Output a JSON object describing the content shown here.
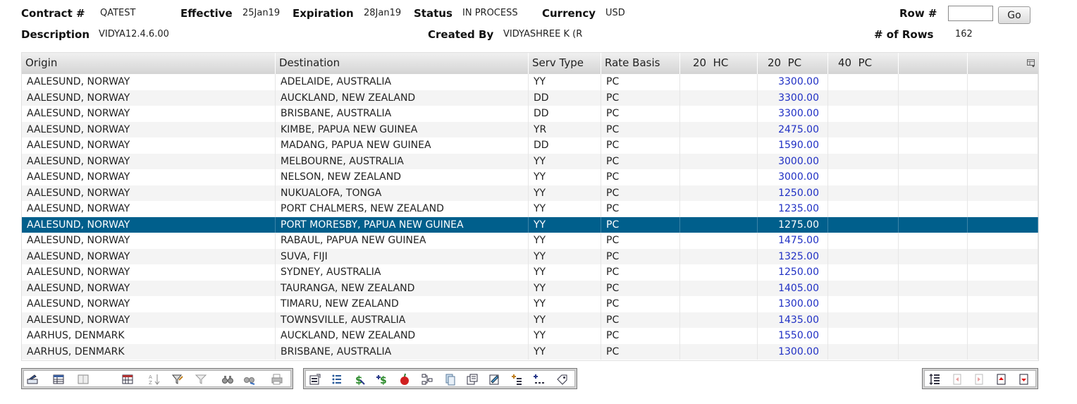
{
  "header": {
    "contract_label": "Contract #",
    "contract_value": "QATEST",
    "effective_label": "Effective",
    "effective_value": "25Jan19",
    "expiration_label": "Expiration",
    "expiration_value": "28Jan19",
    "status_label": "Status",
    "status_value": "IN PROCESS",
    "currency_label": "Currency",
    "currency_value": "USD",
    "row_label": "Row #",
    "row_input_value": "",
    "go_label": "Go",
    "description_label": "Description",
    "description_value": "VIDYA12.4.6.00",
    "created_by_label": "Created By",
    "created_by_value": "VIDYASHREE K (R",
    "rows_label": "# of Rows",
    "rows_value": "162"
  },
  "grid": {
    "columns": [
      "Origin",
      "Destination",
      "Serv Type",
      "Rate Basis",
      "20  HC",
      "20  PC",
      "40  PC",
      "",
      ""
    ],
    "selected_row": 9,
    "rows": [
      {
        "origin": "AALESUND, NORWAY",
        "destination": "ADELAIDE, AUSTRALIA",
        "serv": "YY",
        "basis": "PC",
        "hc20": "",
        "pc20": "3300.00",
        "pc40": ""
      },
      {
        "origin": "AALESUND, NORWAY",
        "destination": "AUCKLAND, NEW ZEALAND",
        "serv": "DD",
        "basis": "PC",
        "hc20": "",
        "pc20": "3300.00",
        "pc40": ""
      },
      {
        "origin": "AALESUND, NORWAY",
        "destination": "BRISBANE, AUSTRALIA",
        "serv": "DD",
        "basis": "PC",
        "hc20": "",
        "pc20": "3300.00",
        "pc40": ""
      },
      {
        "origin": "AALESUND, NORWAY",
        "destination": "KIMBE, PAPUA NEW GUINEA",
        "serv": "YR",
        "basis": "PC",
        "hc20": "",
        "pc20": "2475.00",
        "pc40": ""
      },
      {
        "origin": "AALESUND, NORWAY",
        "destination": "MADANG, PAPUA NEW GUINEA",
        "serv": "DD",
        "basis": "PC",
        "hc20": "",
        "pc20": "1590.00",
        "pc40": ""
      },
      {
        "origin": "AALESUND, NORWAY",
        "destination": "MELBOURNE, AUSTRALIA",
        "serv": "YY",
        "basis": "PC",
        "hc20": "",
        "pc20": "3000.00",
        "pc40": ""
      },
      {
        "origin": "AALESUND, NORWAY",
        "destination": "NELSON, NEW ZEALAND",
        "serv": "YY",
        "basis": "PC",
        "hc20": "",
        "pc20": "3000.00",
        "pc40": ""
      },
      {
        "origin": "AALESUND, NORWAY",
        "destination": "NUKUALOFA, TONGA",
        "serv": "YY",
        "basis": "PC",
        "hc20": "",
        "pc20": "1250.00",
        "pc40": ""
      },
      {
        "origin": "AALESUND, NORWAY",
        "destination": "PORT CHALMERS, NEW ZEALAND",
        "serv": "YY",
        "basis": "PC",
        "hc20": "",
        "pc20": "1235.00",
        "pc40": ""
      },
      {
        "origin": "AALESUND, NORWAY",
        "destination": "PORT MORESBY, PAPUA NEW GUINEA",
        "serv": "YY",
        "basis": "PC",
        "hc20": "",
        "pc20": "1275.00",
        "pc40": ""
      },
      {
        "origin": "AALESUND, NORWAY",
        "destination": "RABAUL, PAPUA NEW GUINEA",
        "serv": "YY",
        "basis": "PC",
        "hc20": "",
        "pc20": "1475.00",
        "pc40": ""
      },
      {
        "origin": "AALESUND, NORWAY",
        "destination": "SUVA, FIJI",
        "serv": "YY",
        "basis": "PC",
        "hc20": "",
        "pc20": "1325.00",
        "pc40": ""
      },
      {
        "origin": "AALESUND, NORWAY",
        "destination": "SYDNEY, AUSTRALIA",
        "serv": "YY",
        "basis": "PC",
        "hc20": "",
        "pc20": "1250.00",
        "pc40": ""
      },
      {
        "origin": "AALESUND, NORWAY",
        "destination": "TAURANGA, NEW ZEALAND",
        "serv": "YY",
        "basis": "PC",
        "hc20": "",
        "pc20": "1405.00",
        "pc40": ""
      },
      {
        "origin": "AALESUND, NORWAY",
        "destination": "TIMARU, NEW ZEALAND",
        "serv": "YY",
        "basis": "PC",
        "hc20": "",
        "pc20": "1300.00",
        "pc40": ""
      },
      {
        "origin": "AALESUND, NORWAY",
        "destination": "TOWNSVILLE, AUSTRALIA",
        "serv": "YY",
        "basis": "PC",
        "hc20": "",
        "pc20": "1435.00",
        "pc40": ""
      },
      {
        "origin": "AARHUS, DENMARK",
        "destination": "AUCKLAND, NEW ZEALAND",
        "serv": "YY",
        "basis": "PC",
        "hc20": "",
        "pc20": "1550.00",
        "pc40": ""
      },
      {
        "origin": "AARHUS, DENMARK",
        "destination": "BRISBANE, AUSTRALIA",
        "serv": "YY",
        "basis": "PC",
        "hc20": "",
        "pc20": "1300.00",
        "pc40": ""
      }
    ]
  },
  "toolbars": {
    "grid_tools": [
      "edit-row-icon",
      "grid-view-icon",
      "blank-view-icon",
      "column-chooser-icon",
      "sort-icon",
      "filter-icon",
      "clear-filter-icon",
      "find-icon",
      "find-next-icon",
      "print-icon"
    ],
    "rate_tools": [
      "properties-icon",
      "list-icon",
      "dollar-icon",
      "add-rate-icon",
      "apple-icon",
      "routing-icon",
      "copy-document-icon",
      "duplicate-icon",
      "notes-icon",
      "add-surcharge-icon",
      "rate-detail-icon",
      "tag-icon"
    ],
    "nav_tools": [
      "row-height-icon",
      "previous-page-icon",
      "next-page-icon",
      "page-up-icon",
      "page-down-icon"
    ]
  }
}
